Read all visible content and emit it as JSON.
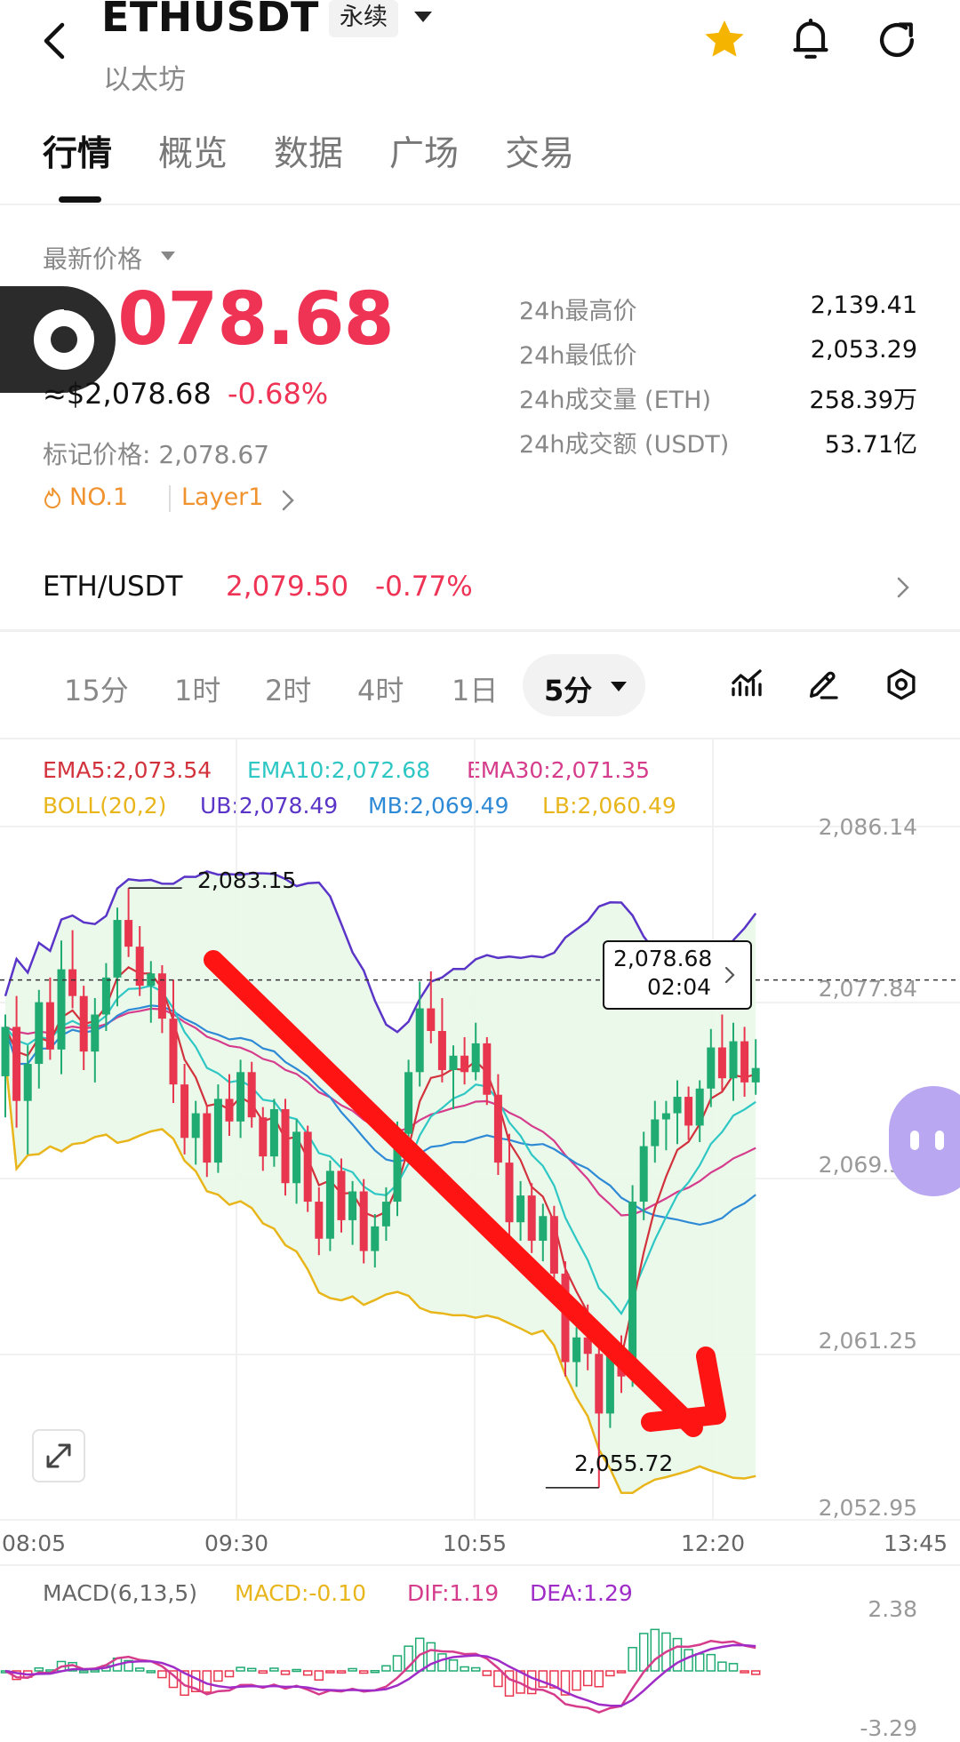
{
  "header": {
    "symbol": "ETHUSDT",
    "contract_type": "永续",
    "subtitle": "以太坊"
  },
  "tabs": [
    {
      "label": "行情",
      "active": true
    },
    {
      "label": "概览",
      "active": false
    },
    {
      "label": "数据",
      "active": false
    },
    {
      "label": "广场",
      "active": false
    },
    {
      "label": "交易",
      "active": false
    }
  ],
  "price": {
    "label": "最新价格",
    "last": "2,078.68",
    "usd_equiv": "≈$2,078.68",
    "change_pct": "-0.68%",
    "mark_price": "标记价格: 2,078.67",
    "rank": "NO.1",
    "category": "Layer1"
  },
  "stats": [
    {
      "label": "24h最高价",
      "value": "2,139.41"
    },
    {
      "label": "24h最低价",
      "value": "2,053.29"
    },
    {
      "label": "24h成交量 (ETH)",
      "value": "258.39万"
    },
    {
      "label": "24h成交额 (USDT)",
      "value": "53.71亿"
    }
  ],
  "spot": {
    "pair": "ETH/USDT",
    "price": "2,079.50",
    "change": "-0.77%"
  },
  "intervals": [
    "15分",
    "1时",
    "2时",
    "4时",
    "1日"
  ],
  "active_interval": "5分",
  "indicators": {
    "ema5": "EMA5:2,073.54",
    "ema10": "EMA10:2,072.68",
    "ema30": "EMA30:2,071.35",
    "boll": "BOLL(20,2)",
    "ub": "UB:2,078.49",
    "mb": "MB:2,069.49",
    "lb": "LB:2,060.49"
  },
  "price_axis": [
    "2,086.14",
    "2,077.84",
    "2,069.55",
    "2,061.25",
    "2,052.95"
  ],
  "time_axis": [
    "08:05",
    "09:30",
    "10:55",
    "12:20",
    "13:45"
  ],
  "annotations": {
    "high": "2,083.15",
    "low": "2,055.72",
    "current_price": "2,078.68",
    "countdown": "02:04"
  },
  "macd": {
    "title": "MACD(6,13,5)",
    "macd": "MACD:-0.10",
    "dif": "DIF:1.19",
    "dea": "DEA:1.29",
    "axis_top": "2.38",
    "axis_bottom": "-3.29"
  },
  "colors": {
    "up": "#1fab72",
    "down": "#e8364f",
    "ema5": "#d2323c",
    "ema10": "#2ec7c4",
    "ema30": "#d63c8c",
    "boll_ub": "#5a35c8",
    "boll_mb": "#2f8ad6",
    "boll_lb": "#e8b51b",
    "accent": "#ee3355",
    "tag": "#f0922d"
  },
  "chart_data": {
    "type": "candlestick",
    "interval": "5分",
    "x_labels": [
      "08:05",
      "09:30",
      "10:55",
      "12:20",
      "13:45"
    ],
    "ylim": [
      2052.95,
      2086.14
    ],
    "candles": [
      [
        2074.0,
        2077.0,
        2072.0,
        2076.4
      ],
      [
        2076.4,
        2077.9,
        2071.5,
        2072.8
      ],
      [
        2072.8,
        2075.5,
        2070.2,
        2074.6
      ],
      [
        2074.6,
        2078.2,
        2073.4,
        2077.6
      ],
      [
        2077.6,
        2078.8,
        2074.8,
        2075.3
      ],
      [
        2075.3,
        2080.6,
        2074.1,
        2079.2
      ],
      [
        2079.2,
        2081.1,
        2077.3,
        2077.9
      ],
      [
        2077.9,
        2078.4,
        2074.3,
        2075.2
      ],
      [
        2075.2,
        2077.8,
        2073.7,
        2077.0
      ],
      [
        2077.0,
        2079.5,
        2076.2,
        2078.8
      ],
      [
        2078.8,
        2082.2,
        2077.4,
        2081.6
      ],
      [
        2081.6,
        2083.15,
        2079.8,
        2080.3
      ],
      [
        2080.3,
        2081.3,
        2077.9,
        2078.4
      ],
      [
        2078.4,
        2079.6,
        2076.6,
        2079.0
      ],
      [
        2079.0,
        2079.4,
        2076.1,
        2076.8
      ],
      [
        2076.8,
        2078.7,
        2072.7,
        2073.6
      ],
      [
        2073.6,
        2074.6,
        2070.2,
        2071.0
      ],
      [
        2071.0,
        2072.8,
        2069.7,
        2072.2
      ],
      [
        2072.2,
        2072.6,
        2069.1,
        2069.8
      ],
      [
        2069.8,
        2073.6,
        2069.3,
        2072.9
      ],
      [
        2072.9,
        2074.1,
        2071.1,
        2071.8
      ],
      [
        2071.8,
        2074.8,
        2071.0,
        2074.2
      ],
      [
        2074.2,
        2074.7,
        2071.5,
        2072.0
      ],
      [
        2072.0,
        2072.5,
        2069.4,
        2070.1
      ],
      [
        2070.1,
        2072.9,
        2069.6,
        2072.4
      ],
      [
        2072.4,
        2072.9,
        2068.2,
        2068.8
      ],
      [
        2068.8,
        2071.9,
        2067.8,
        2071.3
      ],
      [
        2071.3,
        2071.6,
        2067.4,
        2067.9
      ],
      [
        2067.9,
        2068.6,
        2065.3,
        2066.1
      ],
      [
        2066.1,
        2069.9,
        2065.5,
        2069.4
      ],
      [
        2069.4,
        2070.0,
        2066.4,
        2067.0
      ],
      [
        2067.0,
        2068.9,
        2065.8,
        2068.4
      ],
      [
        2068.4,
        2069.0,
        2064.9,
        2065.5
      ],
      [
        2065.5,
        2067.3,
        2064.7,
        2066.7
      ],
      [
        2066.7,
        2068.6,
        2066.0,
        2067.9
      ],
      [
        2067.9,
        2071.8,
        2067.2,
        2071.2
      ],
      [
        2071.2,
        2074.8,
        2070.6,
        2074.2
      ],
      [
        2074.2,
        2078.6,
        2073.5,
        2077.3
      ],
      [
        2077.3,
        2079.1,
        2075.6,
        2076.2
      ],
      [
        2076.2,
        2077.8,
        2073.7,
        2074.3
      ],
      [
        2074.3,
        2075.5,
        2072.4,
        2075.0
      ],
      [
        2075.0,
        2075.9,
        2073.6,
        2074.2
      ],
      [
        2074.2,
        2076.6,
        2073.8,
        2075.6
      ],
      [
        2075.6,
        2075.9,
        2072.6,
        2073.1
      ],
      [
        2073.1,
        2074.1,
        2069.2,
        2069.8
      ],
      [
        2069.8,
        2071.2,
        2066.2,
        2066.9
      ],
      [
        2066.9,
        2068.9,
        2066.0,
        2068.2
      ],
      [
        2068.2,
        2068.8,
        2065.4,
        2066.0
      ],
      [
        2066.0,
        2067.8,
        2065.0,
        2067.2
      ],
      [
        2067.2,
        2067.7,
        2063.7,
        2064.4
      ],
      [
        2064.4,
        2065.0,
        2059.4,
        2060.1
      ],
      [
        2060.1,
        2061.8,
        2058.9,
        2061.3
      ],
      [
        2061.3,
        2062.9,
        2059.7,
        2060.5
      ],
      [
        2060.5,
        2061.0,
        2055.72,
        2057.6
      ],
      [
        2057.6,
        2061.2,
        2056.9,
        2060.6
      ],
      [
        2060.6,
        2061.4,
        2058.6,
        2059.4
      ],
      [
        2059.4,
        2068.7,
        2058.9,
        2067.9
      ],
      [
        2067.9,
        2071.3,
        2067.0,
        2070.6
      ],
      [
        2070.6,
        2072.8,
        2069.8,
        2071.9
      ],
      [
        2071.9,
        2072.8,
        2070.4,
        2072.2
      ],
      [
        2072.2,
        2073.8,
        2070.7,
        2073.0
      ],
      [
        2073.0,
        2073.5,
        2070.9,
        2071.6
      ],
      [
        2071.6,
        2073.8,
        2070.8,
        2073.4
      ],
      [
        2073.4,
        2076.3,
        2072.5,
        2075.4
      ],
      [
        2075.4,
        2077.0,
        2073.3,
        2073.9
      ],
      [
        2073.9,
        2076.6,
        2072.8,
        2075.7
      ],
      [
        2075.7,
        2076.4,
        2073.0,
        2073.7
      ],
      [
        2073.7,
        2075.8,
        2073.1,
        2074.4
      ]
    ],
    "annotations": {
      "high": 2083.15,
      "low": 2055.72,
      "current": 2078.68
    }
  }
}
